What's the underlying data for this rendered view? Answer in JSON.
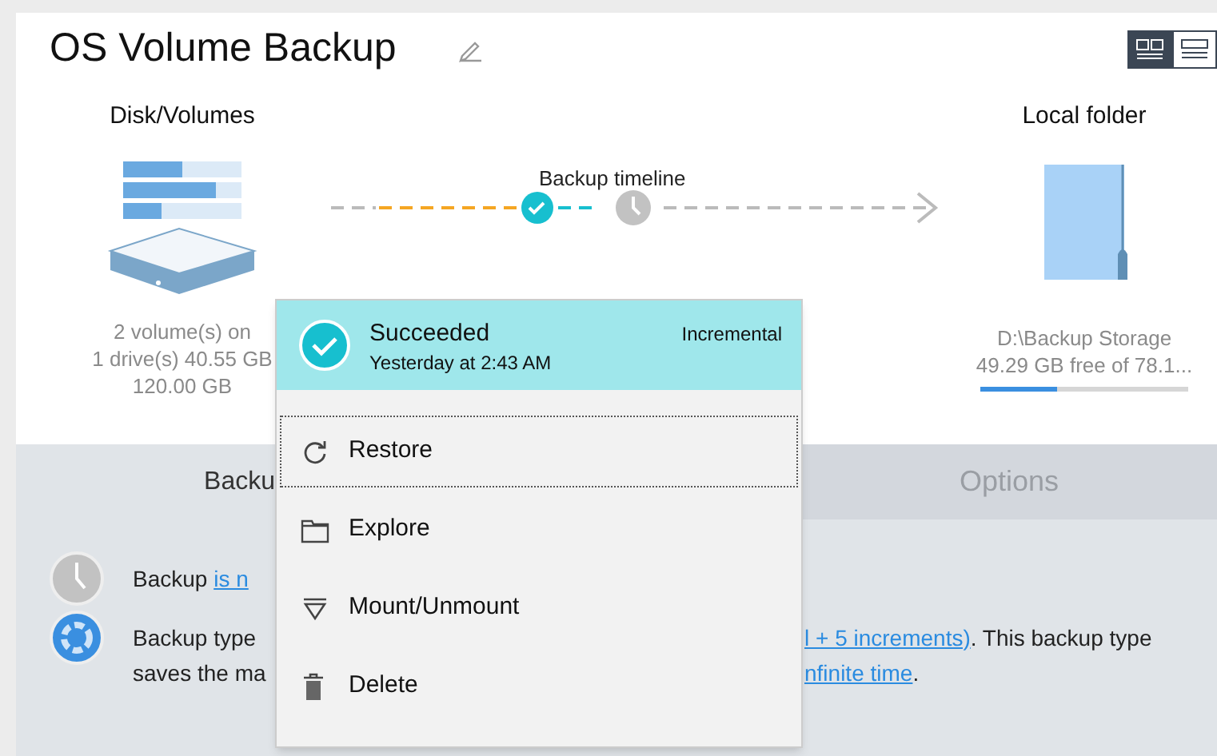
{
  "title": "OS Volume Backup",
  "view_toggle": [
    {
      "kind": "cards",
      "selected": true
    },
    {
      "kind": "list",
      "selected": false
    }
  ],
  "source": {
    "heading": "Disk/Volumes",
    "lines": [
      "2 volume(s) on",
      "1 drive(s) 40.55 GB",
      "120.00 GB"
    ]
  },
  "timeline": {
    "label": "Backup timeline"
  },
  "target": {
    "heading": "Local folder",
    "lines": [
      "D:\\Backup Storage",
      "49.29 GB free of 78.1..."
    ],
    "level": 0.37
  },
  "tabs": [
    {
      "label": "Backu",
      "selected": true
    },
    {
      "label": "Options",
      "selected": false
    }
  ],
  "info_rows": [
    {
      "kind": "schedule",
      "left": [
        {
          "text": "Backup "
        },
        {
          "text": "is n",
          "link": true
        }
      ],
      "right": []
    },
    {
      "kind": "type",
      "left": [
        {
          "text": "Backup type"
        }
      ],
      "right": [
        {
          "text": "l + 5 increments)",
          "link": true
        },
        {
          "text": ". This backup type"
        }
      ]
    },
    {
      "kind": "continuation",
      "left": [
        {
          "text": "saves the ma"
        }
      ],
      "right": [
        {
          "text": "nfinite time",
          "link": true
        },
        {
          "text": "."
        }
      ]
    }
  ],
  "menu": {
    "header": {
      "status": "Succeeded",
      "time": "Yesterday at 2:43 AM",
      "type": "Incremental"
    },
    "items": [
      {
        "kind": "restore",
        "label": "Restore",
        "focused": true
      },
      {
        "kind": "explore",
        "label": "Explore",
        "focused": false
      },
      {
        "kind": "mount",
        "label": "Mount/Unmount",
        "focused": false
      },
      {
        "kind": "delete",
        "label": "Delete",
        "focused": false
      }
    ]
  }
}
